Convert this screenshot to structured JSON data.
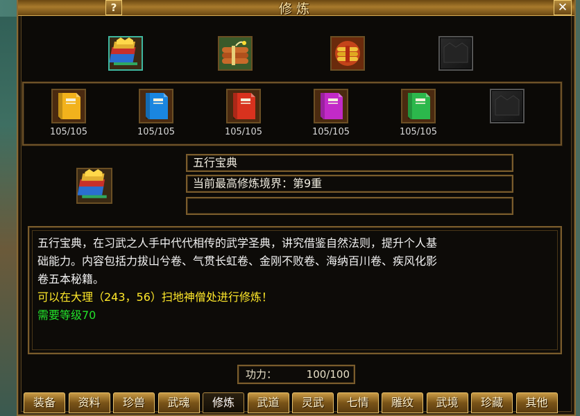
{
  "window": {
    "title": "修炼",
    "help_label": "?",
    "close_label": "✕"
  },
  "top_skills": [
    {
      "icon": "gold-book-bundle-icon",
      "selected": true
    },
    {
      "icon": "dynamite-bundle-icon",
      "selected": false
    },
    {
      "icon": "golden-scroll-bundle-icon",
      "selected": false
    },
    {
      "icon": "empty-slot-icon",
      "selected": false
    }
  ],
  "books": [
    {
      "icon": "yellow-book-icon",
      "count": "105/105",
      "color": "#f2b21c"
    },
    {
      "icon": "blue-book-icon",
      "count": "105/105",
      "color": "#1a86e0"
    },
    {
      "icon": "red-book-icon",
      "count": "105/105",
      "color": "#d8321e"
    },
    {
      "icon": "purple-book-icon",
      "count": "105/105",
      "color": "#c22ac8"
    },
    {
      "icon": "green-book-icon",
      "count": "105/105",
      "color": "#2cb84c"
    },
    {
      "icon": "empty-slot-icon",
      "count": "",
      "color": ""
    }
  ],
  "detail": {
    "icon": "gold-book-bundle-icon",
    "name": "五行宝典",
    "realm": "当前最高修炼境界：第9重",
    "extra": ""
  },
  "description": {
    "line1": "五行宝典，在习武之人手中代代相传的武学圣典，讲究借鉴自然法则，提升个人基",
    "line2": "础能力。内容包括力拔山兮卷、气贯长虹卷、金刚不败卷、海纳百川卷、疾风化影",
    "line3": "卷五本秘籍。",
    "location": "可以在大理（243，56）扫地神僧处进行修炼！",
    "requirement": "需要等级70"
  },
  "power": {
    "label": "功力：",
    "value": "100/100"
  },
  "tabs": [
    {
      "label": "装备",
      "active": false
    },
    {
      "label": "资料",
      "active": false
    },
    {
      "label": "珍兽",
      "active": false
    },
    {
      "label": "武魂",
      "active": false
    },
    {
      "label": "修炼",
      "active": true
    },
    {
      "label": "武道",
      "active": false
    },
    {
      "label": "灵武",
      "active": false
    },
    {
      "label": "七情",
      "active": false
    },
    {
      "label": "雕纹",
      "active": false
    },
    {
      "label": "武境",
      "active": false
    },
    {
      "label": "珍藏",
      "active": false
    },
    {
      "label": "其他",
      "active": false
    }
  ],
  "colors": {
    "frame_gold": "#8a6a34",
    "text_yellow": "#ffe82a",
    "text_green": "#22e22a"
  }
}
